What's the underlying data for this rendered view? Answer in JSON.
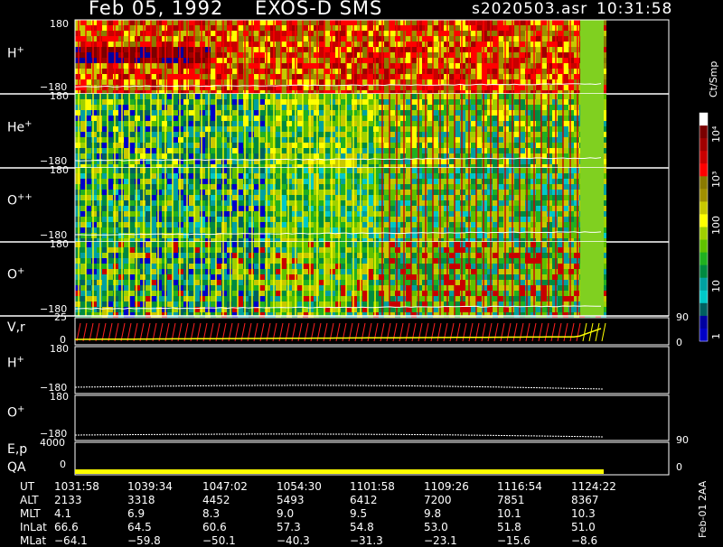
{
  "header": {
    "date": "Feb 05, 1992",
    "instrument": "EXOS-D SMS",
    "file": "s2020503.asr",
    "time": "10:31:58"
  },
  "panels": [
    {
      "key": "hplus",
      "label": "H",
      "sup": "+",
      "top": "180",
      "bottom": "−180"
    },
    {
      "key": "heplus",
      "label": "He",
      "sup": "+",
      "top": "180",
      "bottom": "−180"
    },
    {
      "key": "oplus2",
      "label": "O",
      "sup": "++",
      "top": "180",
      "bottom": "−180"
    },
    {
      "key": "oplus",
      "label": "O",
      "sup": "+",
      "top": "180",
      "bottom": "−180"
    }
  ],
  "vr": {
    "label": "V,r",
    "left_top": "25",
    "left_bottom": "0",
    "right_top": "90",
    "right_bottom": "0"
  },
  "hline": {
    "label": "H",
    "sup": "+",
    "top": "180",
    "bottom": "−180"
  },
  "oline": {
    "label": "O",
    "sup": "+",
    "top": "180",
    "bottom": "−180"
  },
  "ep": {
    "label": "E,p",
    "left_top": "4000",
    "right_top": "90"
  },
  "qa": {
    "label": "QA",
    "left_bottom": "0",
    "right_bottom": "0"
  },
  "colorbar": {
    "unit": "Ct/Smp",
    "ticks": [
      "10⁴",
      "10³",
      "100",
      "10",
      "1"
    ],
    "colors": [
      "#ffffff",
      "#7a0000",
      "#a00000",
      "#c80000",
      "#ff0000",
      "#8a7a00",
      "#a09000",
      "#c8c800",
      "#ffff00",
      "#a0d000",
      "#60c000",
      "#20b020",
      "#008a40",
      "#00a0a0",
      "#00c8c8",
      "#006060",
      "#0000a0",
      "#0000c8"
    ]
  },
  "orbit": {
    "labels": [
      "UT",
      "ALT",
      "MLT",
      "InLat",
      "MLat"
    ],
    "columns": [
      [
        "1031:58",
        "2133",
        "4.1",
        "66.6",
        "−64.1"
      ],
      [
        "1039:34",
        "3318",
        "6.9",
        "64.5",
        "−59.8"
      ],
      [
        "1047:02",
        "4452",
        "8.3",
        "60.6",
        "−50.1"
      ],
      [
        "1054:30",
        "5493",
        "9.0",
        "57.3",
        "−40.3"
      ],
      [
        "1101:58",
        "6412",
        "9.5",
        "54.8",
        "−31.3"
      ],
      [
        "1109:26",
        "7200",
        "9.8",
        "53.0",
        "−23.1"
      ],
      [
        "1116:54",
        "7851",
        "10.1",
        "51.8",
        "−15.6"
      ],
      [
        "1124:22",
        "8367",
        "10.3",
        "51.0",
        "−8.6"
      ]
    ]
  },
  "side_note": "Feb-01 2AA"
}
